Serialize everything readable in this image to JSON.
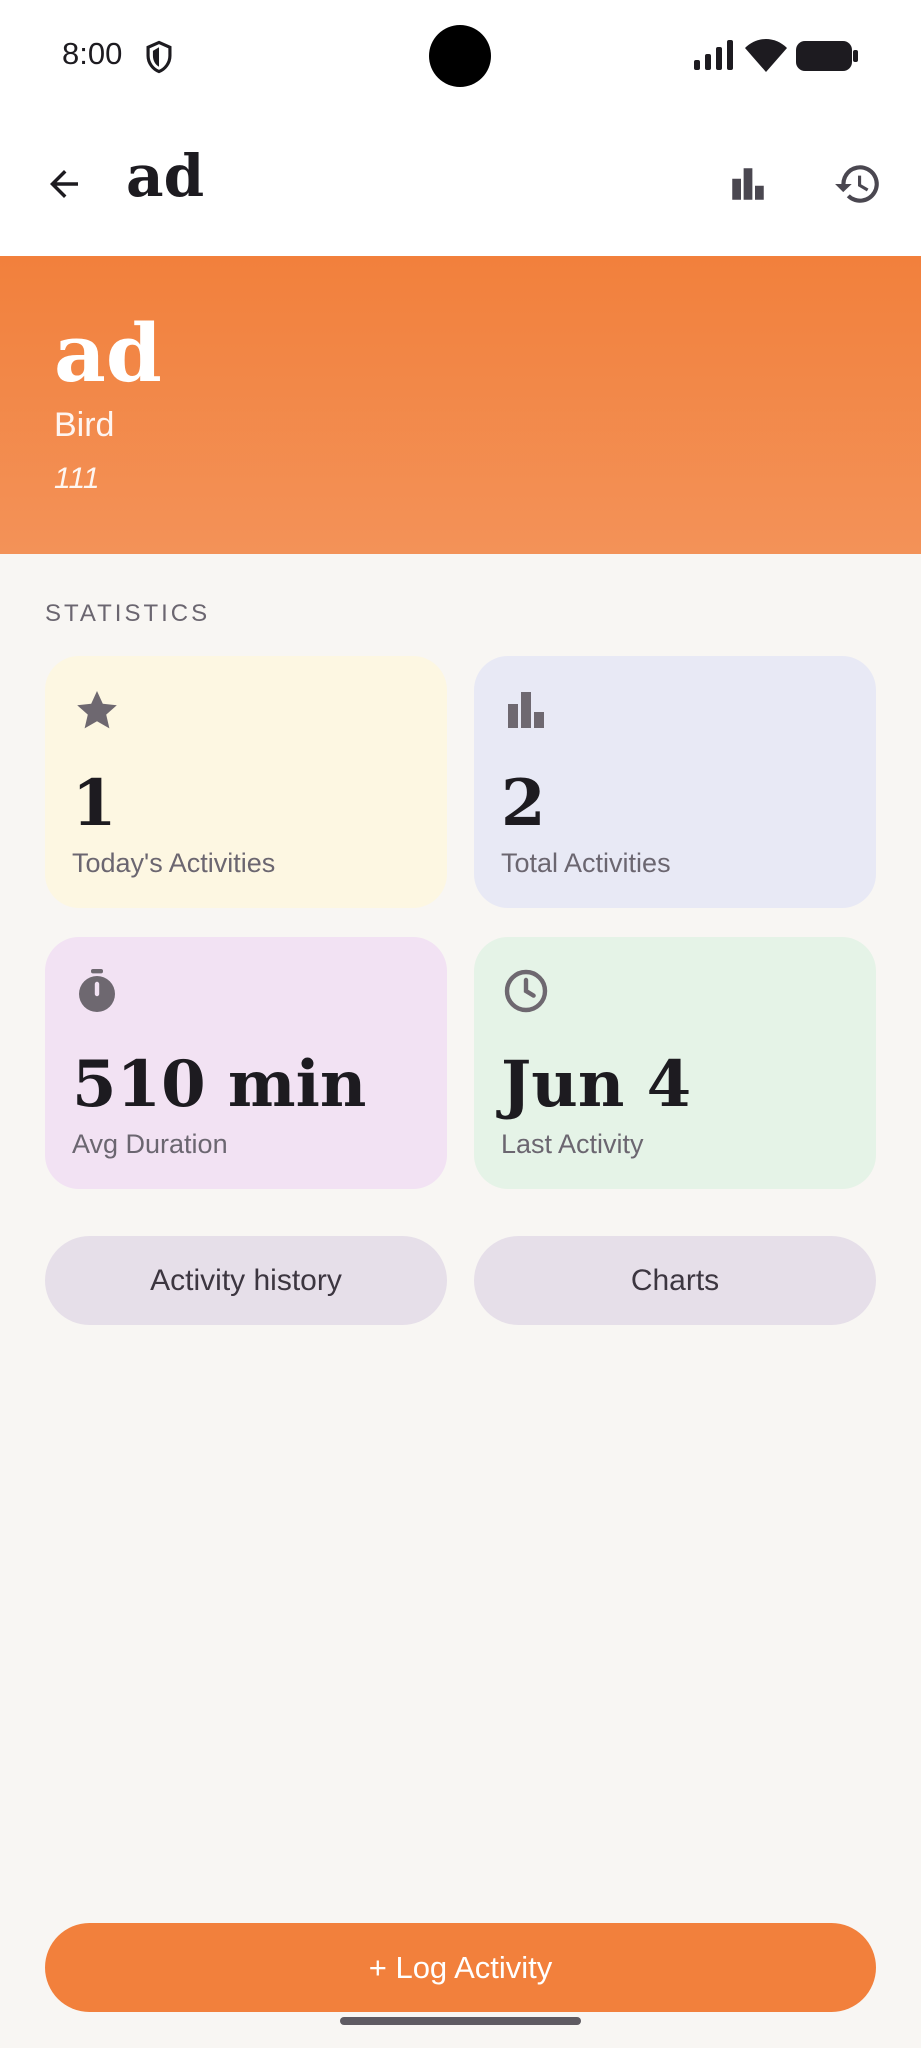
{
  "status_bar": {
    "time": "8:00"
  },
  "app_bar": {
    "title": "ad"
  },
  "hero": {
    "name": "ad",
    "type": "Bird",
    "note": "111"
  },
  "statistics": {
    "section_label": "STATISTICS",
    "cards": [
      {
        "value": "1",
        "label": "Today's Activities",
        "icon": "star-icon"
      },
      {
        "value": "2",
        "label": "Total Activities",
        "icon": "bar-chart-icon"
      },
      {
        "value": "510 min",
        "label": "Avg Duration",
        "icon": "timer-icon"
      },
      {
        "value": "Jun 4",
        "label": "Last Activity",
        "icon": "clock-icon"
      }
    ]
  },
  "actions": {
    "history_label": "Activity history",
    "charts_label": "Charts"
  },
  "fab": {
    "label": "+ Log Activity"
  },
  "colors": {
    "accent": "#f2803c",
    "card_yellow": "#fdf7e2",
    "card_blue": "#e8e9f5",
    "card_purple": "#f2e2f3",
    "card_green": "#e5f3e7"
  }
}
